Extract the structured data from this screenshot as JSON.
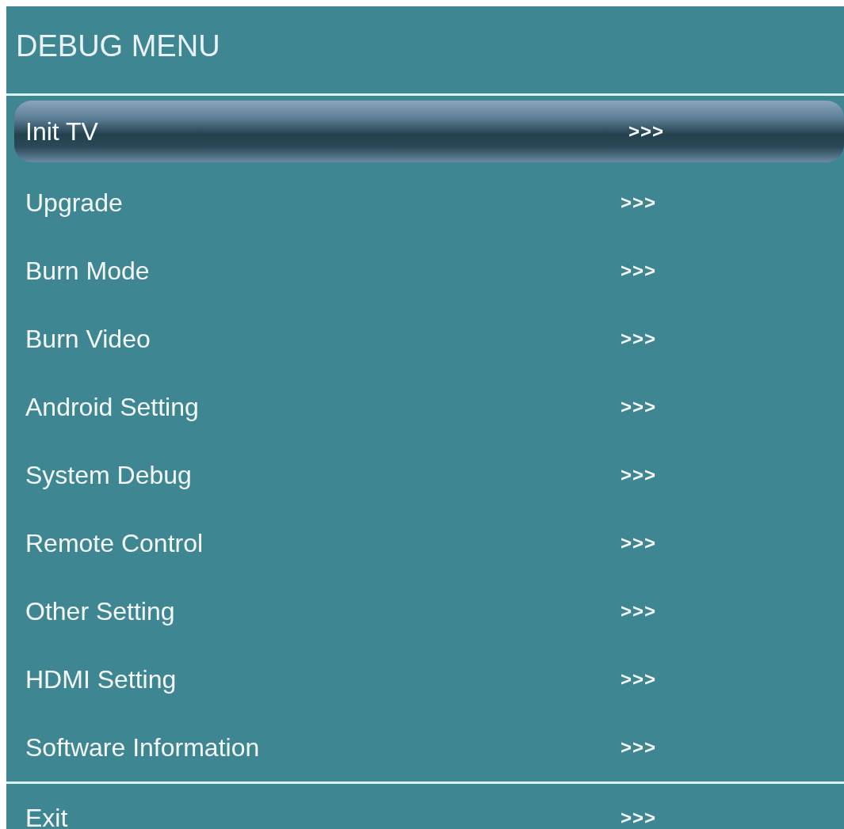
{
  "title": "DEBUG MENU",
  "items": [
    {
      "label": "Init TV",
      "arrow": ">>>",
      "selected": true
    },
    {
      "label": "Upgrade",
      "arrow": ">>>",
      "selected": false
    },
    {
      "label": "Burn Mode",
      "arrow": ">>>",
      "selected": false
    },
    {
      "label": "Burn Video",
      "arrow": ">>>",
      "selected": false
    },
    {
      "label": "Android Setting",
      "arrow": ">>>",
      "selected": false
    },
    {
      "label": "System Debug",
      "arrow": ">>>",
      "selected": false
    },
    {
      "label": "Remote Control",
      "arrow": ">>>",
      "selected": false
    },
    {
      "label": "Other Setting",
      "arrow": ">>>",
      "selected": false
    },
    {
      "label": "HDMI Setting",
      "arrow": ">>>",
      "selected": false
    },
    {
      "label": "Software Information",
      "arrow": ">>>",
      "selected": false
    }
  ],
  "exit_item": {
    "label": "Exit",
    "arrow": ">>>",
    "selected": false
  }
}
